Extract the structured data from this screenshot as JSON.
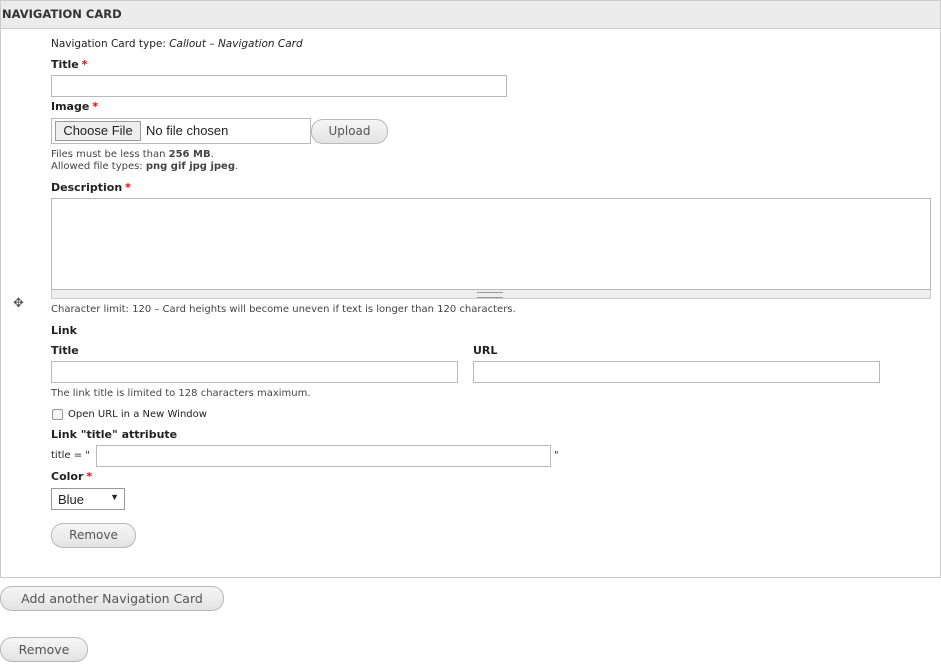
{
  "panel": {
    "title": "NAVIGATION CARD"
  },
  "card_type": {
    "label": "Navigation Card type:",
    "value": "Callout – Navigation Card"
  },
  "title_field": {
    "label": "Title",
    "required": "*",
    "value": ""
  },
  "image_field": {
    "label": "Image",
    "required": "*",
    "choose_label": "Choose File",
    "file_status": "No file chosen",
    "upload_label": "Upload",
    "help_size_prefix": "Files must be less than",
    "help_size_value": "256 MB",
    "help_size_suffix": ".",
    "help_types_prefix": "Allowed file types:",
    "help_types_value": "png gif jpg jpeg",
    "help_types_suffix": "."
  },
  "description_field": {
    "label": "Description",
    "required": "*",
    "value": "",
    "help": "Character limit: 120 – Card heights will become uneven if text is longer than 120 characters."
  },
  "link": {
    "heading": "Link",
    "title_label": "Title",
    "title_value": "",
    "url_label": "URL",
    "url_value": "",
    "help": "The link title is limited to 128 characters maximum.",
    "new_window_label": "Open URL in a New Window",
    "new_window_checked": false,
    "attr_heading": "Link \"title\" attribute",
    "attr_prefix": "title = \"",
    "attr_suffix": "\"",
    "attr_value": ""
  },
  "color_field": {
    "label": "Color",
    "required": "*",
    "selected": "Blue"
  },
  "buttons": {
    "remove_card": "Remove",
    "add_another": "Add another Navigation Card",
    "remove_all": "Remove"
  },
  "icons": {
    "drag_handle": "move-arrows-icon",
    "select_arrow": "triangle-down-icon"
  }
}
